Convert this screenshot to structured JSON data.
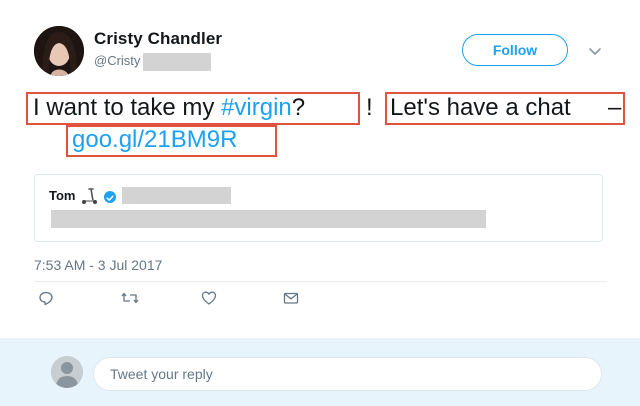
{
  "author": {
    "display_name": "Cristy Chandler",
    "handle_visible": "@Cristy",
    "avatar_icon": "avatar-photo"
  },
  "follow_button": {
    "label": "Follow"
  },
  "menu_icon": "chevron-down-icon",
  "tweet": {
    "part1": "I want to take my ",
    "hashtag": "#virgin",
    "question_mark": "?",
    "exclaim": "!",
    "part2": "Let's have a chat",
    "dash": "–",
    "link": "goo.gl/21BM9R"
  },
  "quoted_tweet": {
    "name": "Tom",
    "emoji_icon": "scooter-icon",
    "verified_icon": "verified-badge-icon"
  },
  "timestamp": "7:53 AM - 3 Jul 2017",
  "actions": [
    {
      "name": "reply",
      "icon": "reply-icon"
    },
    {
      "name": "retweet",
      "icon": "retweet-icon"
    },
    {
      "name": "like",
      "icon": "heart-icon"
    },
    {
      "name": "message",
      "icon": "envelope-icon"
    }
  ],
  "reply": {
    "placeholder": "Tweet your reply"
  },
  "colors": {
    "accent": "#1da1f2",
    "highlight_box": "#e0543f",
    "reply_bar": "#e8f4fb",
    "muted_text": "#657786"
  }
}
